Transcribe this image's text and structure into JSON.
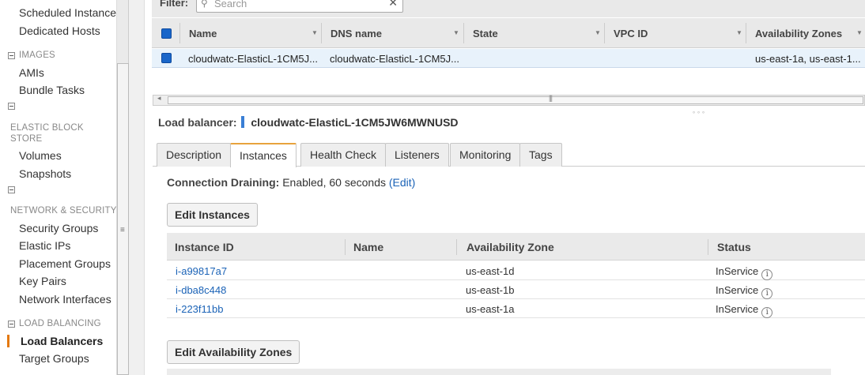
{
  "sidebar": {
    "top_items": [
      "Scheduled Instances",
      "Dedicated Hosts"
    ],
    "images_section": "IMAGES",
    "images_items": [
      "AMIs",
      "Bundle Tasks"
    ],
    "ebs_section": "ELASTIC BLOCK STORE",
    "ebs_items": [
      "Volumes",
      "Snapshots"
    ],
    "net_section": "NETWORK & SECURITY",
    "net_items": [
      "Security Groups",
      "Elastic IPs",
      "Placement Groups",
      "Key Pairs",
      "Network Interfaces"
    ],
    "lb_section": "LOAD BALANCING",
    "lb_active": "Load Balancers",
    "lb_items": [
      "Target Groups"
    ]
  },
  "filter": {
    "label": "Filter:",
    "placeholder": "Search"
  },
  "list_table": {
    "columns": [
      "Name",
      "DNS name",
      "State",
      "VPC ID",
      "Availability Zones"
    ],
    "row": {
      "name": "cloudwatc-ElasticL-1CM5J...",
      "dns": "cloudwatc-ElasticL-1CM5J...",
      "state": "",
      "vpc": "",
      "zones": "us-east-1a, us-east-1..."
    }
  },
  "detail": {
    "label": "Load balancer:",
    "name": "cloudwatc-ElasticL-1CM5JW6MWNUSD",
    "tabs": [
      "Description",
      "Instances",
      "Health Check",
      "Listeners",
      "Monitoring",
      "Tags"
    ],
    "active_tab": "Instances",
    "draining_label": "Connection Draining:",
    "draining_value": " Enabled, 60 seconds ",
    "draining_edit": "(Edit)",
    "edit_instances": "Edit Instances",
    "edit_zones": "Edit Availability Zones"
  },
  "instances_table": {
    "columns": [
      "Instance ID",
      "Name",
      "Availability Zone",
      "Status"
    ],
    "rows": [
      {
        "id": "i-a99817a7",
        "name": "",
        "zone": "us-east-1d",
        "status": "InService"
      },
      {
        "id": "i-dba8c448",
        "name": "",
        "zone": "us-east-1b",
        "status": "InService"
      },
      {
        "id": "i-223f11bb",
        "name": "",
        "zone": "us-east-1a",
        "status": "InService"
      }
    ]
  },
  "colors": {
    "accent_blue": "#1a66c9",
    "link": "#1b63b7",
    "active_tab": "#e8a33d",
    "active_nav": "#e47911"
  }
}
